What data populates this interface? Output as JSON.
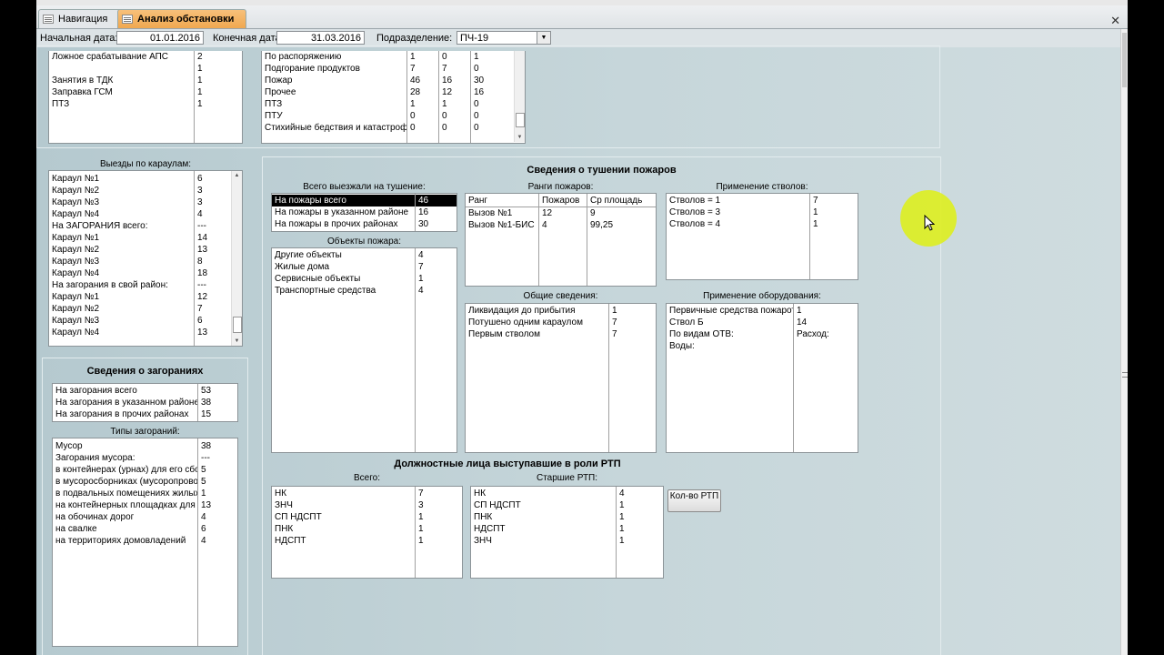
{
  "tabs": [
    {
      "label": "Навигация",
      "active": false
    },
    {
      "label": "Анализ обстановки",
      "active": true
    }
  ],
  "filters": {
    "start_label": "Начальная дата:",
    "start_value": "01.01.2016",
    "end_label": "Конечная дата:",
    "end_value": "31.03.2016",
    "division_label": "Подразделение:",
    "division_value": "ПЧ-19"
  },
  "top_left_list": {
    "rows": [
      [
        "Ложное срабатывание АПС",
        "2"
      ],
      [
        "",
        "1"
      ],
      [
        "Занятия в ТДК",
        "1"
      ],
      [
        "Заправка ГСМ",
        "1"
      ],
      [
        "ПТЗ",
        "1"
      ]
    ]
  },
  "top_mid_list": {
    "rows": [
      [
        "По распоряжению",
        "1",
        "0",
        "1"
      ],
      [
        "Подгорание продуктов",
        "7",
        "7",
        "0"
      ],
      [
        "Пожар",
        "46",
        "16",
        "30"
      ],
      [
        "Прочее",
        "28",
        "12",
        "16"
      ],
      [
        "ПТЗ",
        "1",
        "1",
        "0"
      ],
      [
        "ПТУ",
        "0",
        "0",
        "0"
      ],
      [
        "Стихийные бедствия и катастрофы",
        "0",
        "0",
        "0"
      ]
    ]
  },
  "guards": {
    "title": "Выезды по караулам:",
    "rows": [
      [
        "Караул №1",
        "6"
      ],
      [
        "Караул №2",
        "3"
      ],
      [
        "Караул №3",
        "3"
      ],
      [
        "Караул №4",
        "4"
      ],
      [
        "На ЗАГОРАНИЯ всего:",
        "---"
      ],
      [
        "Караул №1",
        "14"
      ],
      [
        "Караул №2",
        "13"
      ],
      [
        "Караул №3",
        "8"
      ],
      [
        "Караул №4",
        "18"
      ],
      [
        "На загорания в свой район:",
        "---"
      ],
      [
        "Караул №1",
        "12"
      ],
      [
        "Караул №2",
        "7"
      ],
      [
        "Караул №3",
        "6"
      ],
      [
        "Караул №4",
        "13"
      ]
    ]
  },
  "ignitions": {
    "title": "Сведения о загораниях",
    "summary": [
      [
        "На загорания всего",
        "53"
      ],
      [
        "На загорания в указанном районе",
        "38"
      ],
      [
        "На загорания в прочих районах",
        "15"
      ]
    ],
    "types_title": "Типы загораний:",
    "types": [
      [
        "Мусор",
        "38"
      ],
      [
        "Загорания мусора:",
        "---"
      ],
      [
        "в контейнерах (урнах) для его сбора",
        "5"
      ],
      [
        "в мусоросборниках (мусоропроводах)",
        "5"
      ],
      [
        "в подвальных помещениях жилых домов",
        "1"
      ],
      [
        "на контейнерных площадках для мусора",
        "13"
      ],
      [
        "на обочинах дорог",
        "4"
      ],
      [
        "на свалке",
        "6"
      ],
      [
        "на территориях домовладений",
        "4"
      ]
    ]
  },
  "fires": {
    "title": "Сведения о тушении пожаров",
    "total_title": "Всего выезжали на тушение:",
    "total_rows": [
      [
        "На пожары всего",
        "46"
      ],
      [
        "На пожары в указанном районе",
        "16"
      ],
      [
        "На пожары в прочих районах",
        "30"
      ]
    ],
    "objects_title": "Объекты пожара:",
    "objects_rows": [
      [
        "Другие объекты",
        "4"
      ],
      [
        "Жилые дома",
        "7"
      ],
      [
        "Сервисные объекты",
        "1"
      ],
      [
        "Транспортные средства",
        "4"
      ]
    ],
    "ranks_title": "Ранги пожаров:",
    "ranks_header": [
      "Ранг",
      "Пожаров",
      "Ср площадь"
    ],
    "ranks_rows": [
      [
        "Вызов №1",
        "12",
        "9"
      ],
      [
        "Вызов №1-БИС",
        "4",
        "99,25"
      ]
    ],
    "general_title": "Общие сведения:",
    "general_rows": [
      [
        "Ликвидация до прибытия",
        "1"
      ],
      [
        "Потушено одним караулом",
        "7"
      ],
      [
        "Первым стволом",
        "7"
      ]
    ],
    "nozzles_title": "Применение стволов:",
    "nozzles_rows": [
      [
        "Стволов = 1",
        "7"
      ],
      [
        "Стволов = 3",
        "1"
      ],
      [
        "Стволов = 4",
        "1"
      ]
    ],
    "equipment_title": "Применение оборудования:",
    "equipment_rows": [
      [
        "Первичные средства пожаротушения",
        "1"
      ],
      [
        "Ствол Б",
        "14"
      ],
      [
        "По видам ОТВ:",
        "Расход:"
      ],
      [
        "Воды:",
        ""
      ]
    ]
  },
  "officials": {
    "title": "Должностные лица выступавшие в роли РТП",
    "all_title": "Всего:",
    "all_rows": [
      [
        "НК",
        "7"
      ],
      [
        "ЗНЧ",
        "3"
      ],
      [
        "СП НДСПТ",
        "1"
      ],
      [
        "ПНК",
        "1"
      ],
      [
        "НДСПТ",
        "1"
      ]
    ],
    "senior_title": "Старшие РТП:",
    "senior_rows": [
      [
        "НК",
        "4"
      ],
      [
        "СП НДСПТ",
        "1"
      ],
      [
        "ПНК",
        "1"
      ],
      [
        "НДСПТ",
        "1"
      ],
      [
        "ЗНЧ",
        "1"
      ]
    ],
    "count_button": "Кол-во РТП"
  }
}
